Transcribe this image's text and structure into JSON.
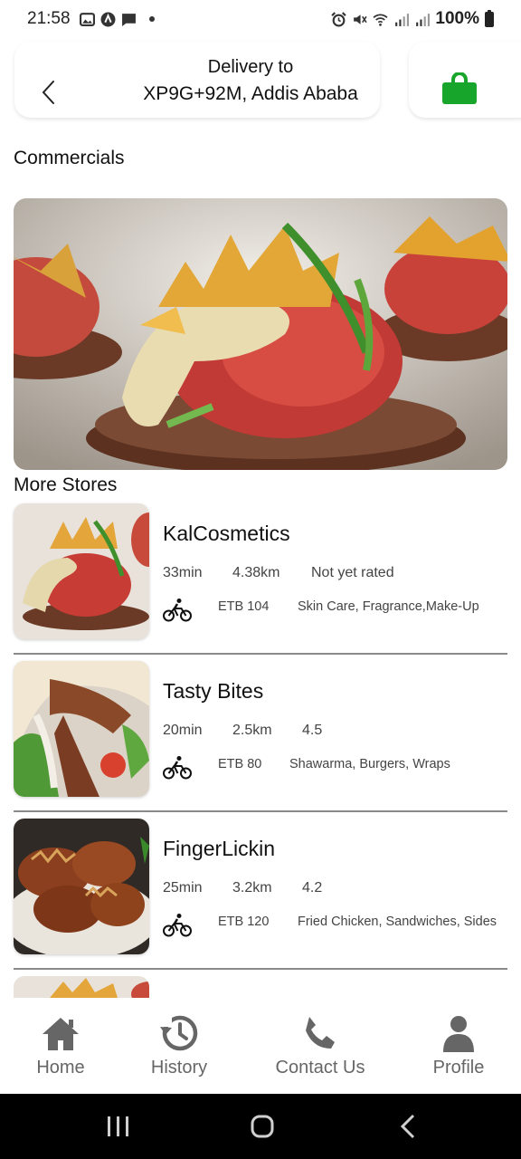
{
  "status_bar": {
    "time": "21:58",
    "battery": "100%"
  },
  "header": {
    "title": "Delivery to",
    "address": "XP9G+92M, Addis Ababa",
    "bag_color": "#17a52b"
  },
  "commercials": {
    "title": "Commercials"
  },
  "stores": {
    "title": "More Stores",
    "items": [
      {
        "name": "KalCosmetics",
        "time": "33min",
        "distance": "4.38km",
        "rating": "Not yet rated",
        "price": "ETB 104",
        "categories": "Skin Care, Fragrance,Make-Up"
      },
      {
        "name": "Tasty Bites",
        "time": "20min",
        "distance": "2.5km",
        "rating": "4.5",
        "price": "ETB 80",
        "categories": "Shawarma, Burgers, Wraps"
      },
      {
        "name": "FingerLickin",
        "time": "25min",
        "distance": "3.2km",
        "rating": "4.2",
        "price": "ETB 120",
        "categories": "Fried Chicken, Sandwiches, Sides"
      }
    ]
  },
  "bottom_nav": {
    "home": "Home",
    "history": "History",
    "contact": "Contact Us",
    "profile": "Profile"
  }
}
